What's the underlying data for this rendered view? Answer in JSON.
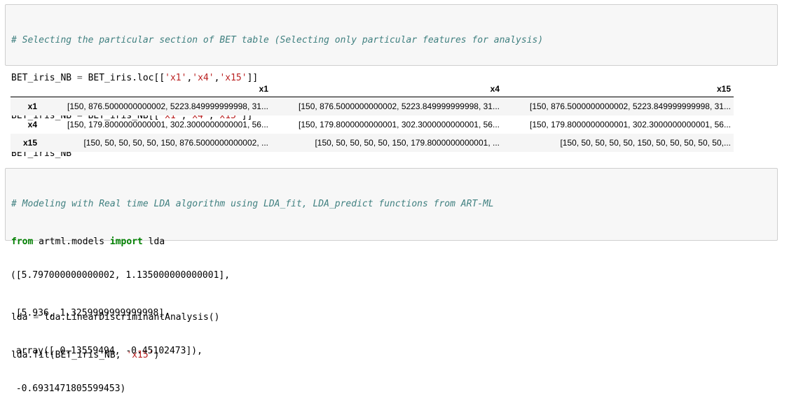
{
  "cell1": {
    "lines": [
      "# Selecting the particular section of BET table (Selecting only particular features for analysis)",
      "BET_iris_NB = BET_iris.loc[['x1','x4','x15']]",
      "BET_iris_NB = BET_iris_NB[['x1','x4','x15']]",
      "BET_iris_NB"
    ]
  },
  "table": {
    "columns": [
      "x1",
      "x4",
      "x15"
    ],
    "rows": [
      {
        "index": "x1",
        "cells": [
          "[150, 876.5000000000002, 5223.849999999998, 31...",
          "[150, 876.5000000000002, 5223.849999999998, 31...",
          "[150, 876.5000000000002, 5223.849999999998, 31..."
        ]
      },
      {
        "index": "x4",
        "cells": [
          "[150, 179.8000000000001, 302.3000000000001, 56...",
          "[150, 179.8000000000001, 302.3000000000001, 56...",
          "[150, 179.8000000000001, 302.3000000000001, 56..."
        ]
      },
      {
        "index": "x15",
        "cells": [
          "[150, 50, 50, 50, 50, 150, 876.5000000000002, ...",
          "[150, 50, 50, 50, 50, 150, 179.8000000000001, ...",
          "[150, 50, 50, 50, 50, 150, 50, 50, 50, 50, 50,..."
        ]
      }
    ]
  },
  "cell2": {
    "lines": [
      "# Modeling with Real time LDA algorithm using LDA_fit, LDA_predict functions from ART-ML",
      "from artml.models import lda",
      "",
      "lda = lda.LinearDiscriminantAnalysis()",
      "lda.fit(BET_iris_NB, 'x15')"
    ]
  },
  "output2": {
    "lines": [
      "([5.797000000000002, 1.135000000000001],",
      " [5.936, 1.3259999999999998],",
      " array([ 0.13559494, -0.45102473]),",
      " -0.6931471805599453)"
    ]
  },
  "colors": {
    "comment": "#408080",
    "keyword": "#008000",
    "string": "#BA2121",
    "cell_background": "#f7f7f7",
    "cell_border": "#cfcfcf"
  }
}
